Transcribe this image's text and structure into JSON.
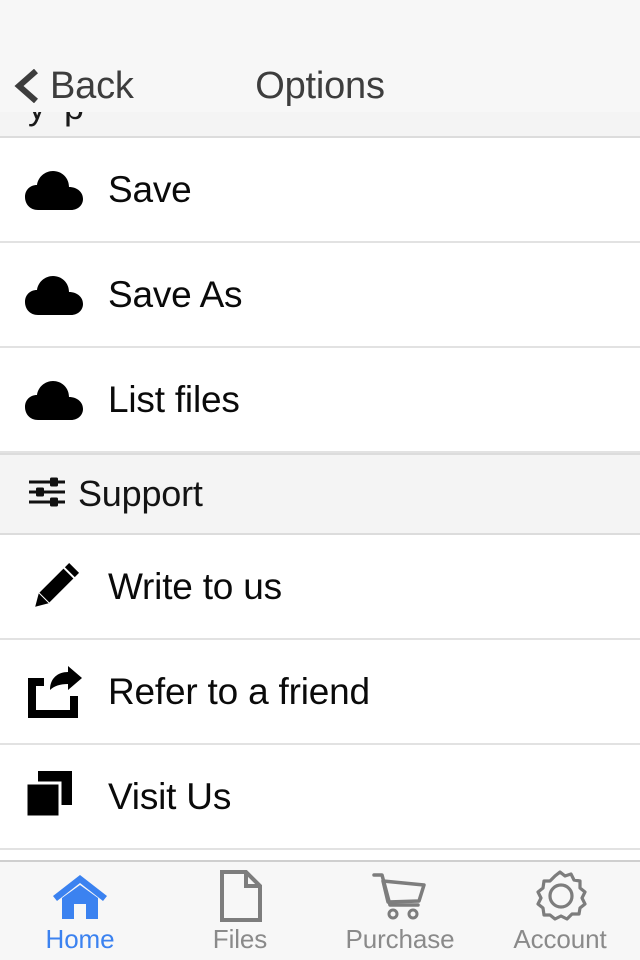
{
  "navbar": {
    "back_label": "Back",
    "back_icon": "chevron-left-icon",
    "title": "Options",
    "background": "#f7f7f7",
    "text_color": "#3d3d3d"
  },
  "peek_section": {
    "note": "partially scrolled section header clipped by the nav bar",
    "background": "#f4f4f4"
  },
  "list": {
    "items": [
      {
        "label": "Save",
        "icon": "cloud-icon",
        "type": "row",
        "name": "list-item-save"
      },
      {
        "label": "Save As",
        "icon": "cloud-icon",
        "type": "row",
        "name": "list-item-save-as"
      },
      {
        "label": "List files",
        "icon": "cloud-icon",
        "type": "row",
        "name": "list-item-list-files"
      },
      {
        "label": "Support",
        "icon": "sliders-icon",
        "type": "section",
        "name": "section-header-support"
      },
      {
        "label": "Write to us",
        "icon": "pencil-icon",
        "type": "row",
        "name": "list-item-write-to-us"
      },
      {
        "label": "Refer to a friend",
        "icon": "share-icon",
        "type": "row",
        "name": "list-item-refer-to-a-friend"
      },
      {
        "label": "Visit Us",
        "icon": "copy-icon",
        "type": "row",
        "name": "list-item-visit-us"
      }
    ],
    "row_background": "#ffffff",
    "separator_color": "#e2e2e2",
    "label_color": "#0a0a0a",
    "icon_color": "#000000"
  },
  "tabbar": {
    "background": "#f7f7f7",
    "active_color": "#3b82f0",
    "inactive_color": "#8a8a8a",
    "tabs": [
      {
        "label": "Home",
        "icon": "home-icon",
        "active": true,
        "name": "tab-home"
      },
      {
        "label": "Files",
        "icon": "file-icon",
        "active": false,
        "name": "tab-files"
      },
      {
        "label": "Purchase",
        "icon": "cart-icon",
        "active": false,
        "name": "tab-purchase"
      },
      {
        "label": "Account",
        "icon": "gear-icon",
        "active": false,
        "name": "tab-account"
      }
    ]
  }
}
